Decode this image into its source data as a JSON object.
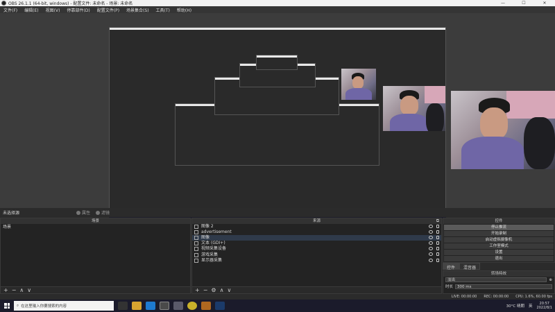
{
  "window": {
    "title": "OBS 26.1.1 (64-bit, windows) - 配置文件: 未命名 - 场景: 未命名",
    "min": "—",
    "max": "☐",
    "close": "✕"
  },
  "menu": [
    "文件(F)",
    "编辑(E)",
    "视图(V)",
    "停靠部件(D)",
    "配置文件(P)",
    "场景集合(S)",
    "工具(T)",
    "帮助(H)"
  ],
  "scene_status": {
    "label": "未选择源",
    "properties": "属性",
    "filters": "滤镜"
  },
  "scenes": {
    "title": "场景",
    "items": [
      "场景"
    ],
    "toolbar": [
      "+",
      "−",
      "∧",
      "∨"
    ]
  },
  "sources": {
    "title": "来源",
    "items": [
      {
        "label": "图像 2",
        "icon": "image-icon"
      },
      {
        "label": "advertisement",
        "icon": "image-icon"
      },
      {
        "label": "图像",
        "icon": "image-icon"
      },
      {
        "label": "文本 (GDI+)",
        "icon": "text-icon"
      },
      {
        "label": "视频采集设备",
        "icon": "camera-icon"
      },
      {
        "label": "游戏采集",
        "icon": "gamepad-icon"
      },
      {
        "label": "显示器采集",
        "icon": "monitor-icon"
      }
    ],
    "toolbar": [
      "+",
      "−",
      "⚙",
      "∧",
      "∨"
    ]
  },
  "controls": {
    "title": "控件",
    "buttons": [
      "停止推流",
      "开始录制",
      "启动虚拟摄像机",
      "工作室模式",
      "设置",
      "退出"
    ]
  },
  "tabs": [
    "控件",
    "混音器"
  ],
  "transitions": {
    "title": "转场特效",
    "selected": "淡出",
    "duration_label": "时长",
    "duration_value": "300 ms"
  },
  "obs_status": {
    "live": "LIVE: 00:00:00",
    "rec": "REC: 00:00:00",
    "cpu": "CPU: 1.6%, 60.00 fps"
  },
  "taskbar": {
    "search_placeholder": "在这里输入你要搜索的内容",
    "weather": "30°C 晴朗",
    "lang": "英",
    "time": "20:57",
    "date": "2022/8/1"
  },
  "colors": {
    "window_bg": "#2b2b2b",
    "panel_bg": "#232323",
    "selection": "#2f3a4a"
  }
}
